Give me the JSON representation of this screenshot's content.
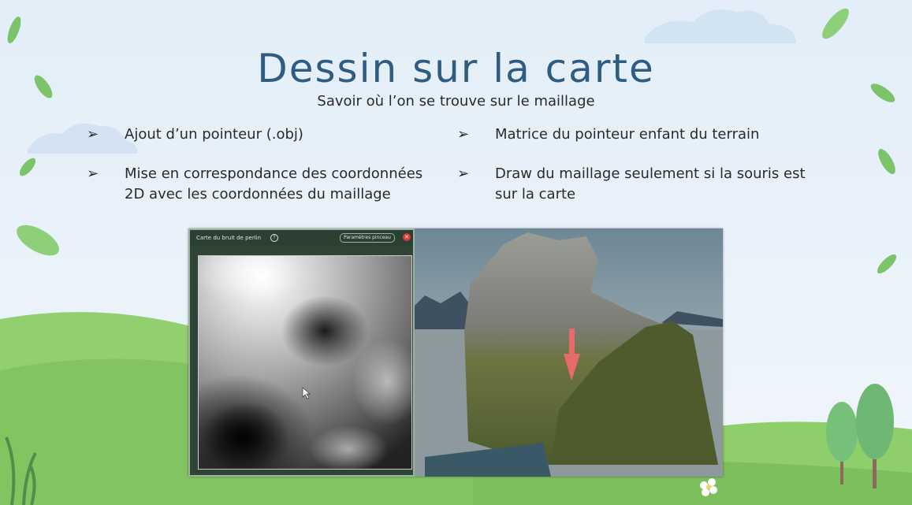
{
  "slide": {
    "title": "Dessin sur la carte",
    "subtitle": "Savoir où l’on se trouve sur le maillage"
  },
  "bullets": [
    {
      "marker": "➢",
      "text_lines": [
        "Ajout d’un pointeur (.obj)"
      ]
    },
    {
      "marker": "➢",
      "text_lines": [
        "Mise en correspondance des coordonnées",
        "2D avec les coordonnées du maillage"
      ]
    },
    {
      "marker": "➢",
      "text_lines": [
        "Matrice du pointeur enfant du terrain"
      ]
    },
    {
      "marker": "➢",
      "text_lines": [
        "Draw du maillage seulement si la souris est",
        "sur la carte"
      ]
    }
  ],
  "screenshot": {
    "panel_title": "Carte du bruit de perlin",
    "help_icon": "?",
    "brush_button_label": "Paramètres pinceau",
    "close_icon": "✕"
  },
  "colors": {
    "title": "#2f5c80",
    "panel_bg": "#2f4434",
    "arrow": "#e86b6b",
    "grass": "#8fcf6b"
  }
}
